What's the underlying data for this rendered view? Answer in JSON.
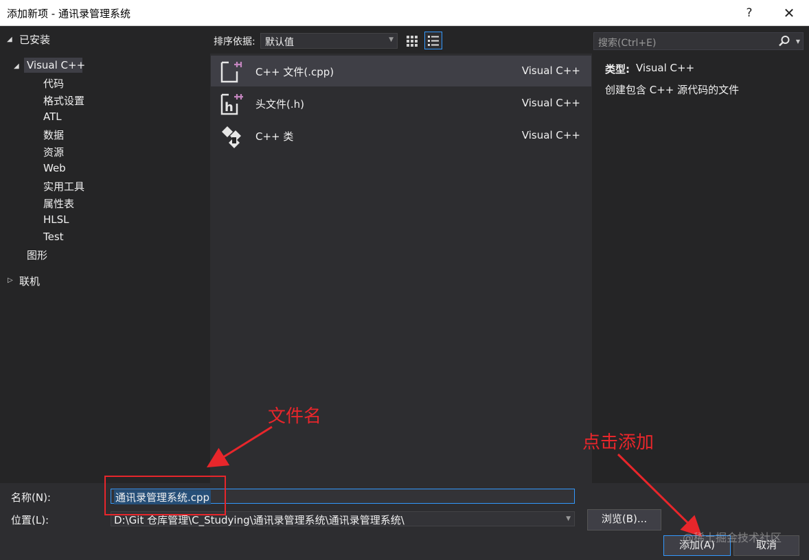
{
  "window": {
    "title": "添加新项 - 通讯录管理系统",
    "help_label": "?",
    "close_label": "✕"
  },
  "tree": {
    "installed": "已安装",
    "visual_cpp": "Visual C++",
    "children": [
      "代码",
      "格式设置",
      "ATL",
      "数据",
      "资源",
      "Web",
      "实用工具",
      "属性表",
      "HLSL",
      "Test"
    ],
    "graphics": "图形",
    "online": "联机"
  },
  "toolbar": {
    "sort_label": "排序依据:",
    "sort_value": "默认值"
  },
  "templates": [
    {
      "name": "C++ 文件(.cpp)",
      "lang": "Visual C++",
      "icon": "cpp-file-icon",
      "selected": true
    },
    {
      "name": "头文件(.h)",
      "lang": "Visual C++",
      "icon": "header-file-icon",
      "selected": false
    },
    {
      "name": "C++ 类",
      "lang": "Visual C++",
      "icon": "cpp-class-icon",
      "selected": false
    }
  ],
  "search": {
    "placeholder": "搜索(Ctrl+E)"
  },
  "details": {
    "type_label": "类型:",
    "type_value": "Visual C++",
    "description": "创建包含 C++ 源代码的文件"
  },
  "form": {
    "name_label": "名称(N):",
    "name_value": "通讯录管理系统.cpp",
    "location_label": "位置(L):",
    "location_value": "D:\\Git 仓库管理\\C_Studying\\通讯录管理系统\\通讯录管理系统\\",
    "browse_label": "浏览(B)...",
    "add_label": "添加(A)",
    "cancel_label": "取消"
  },
  "annotations": {
    "filename": "文件名",
    "click_add": "点击添加",
    "color": "#e8262b"
  },
  "watermark": "@稀土掘金技术社区",
  "colors": {
    "background": "#252526",
    "selected_row": "#3f3f46",
    "accent": "#3399ff"
  }
}
